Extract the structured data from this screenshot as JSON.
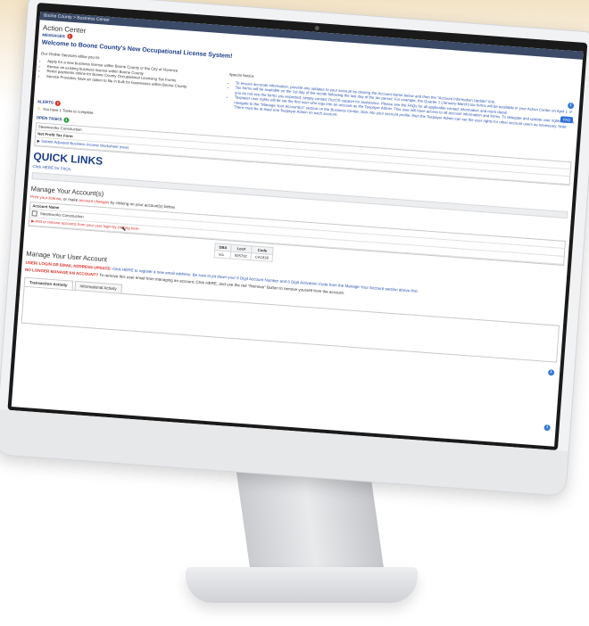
{
  "breadcrumb": {
    "home": "Boone County",
    "sep": ">",
    "current": "Business Center"
  },
  "action_center": {
    "title": "Action Center",
    "messages_label": "MESSAGES",
    "messages_count": "1"
  },
  "welcome": {
    "title": "Welcome to Boone County's New Occupational License System!",
    "intro": "Our Online Services allow you to:",
    "services": [
      "Apply for a new business license within Boone County or the City of Florence",
      "Renew an existing business license within Boone County",
      "Remit payments online for Boone County Occupational Licensing Tax Forms",
      "Service Providers have an option to file in bulk for businesses within Boone County"
    ],
    "special_notice_title": "Special Notice:",
    "notices": [
      "To ensure accurate information, provide any updates to your account by clicking the Account Name below and then the \"Account Information Update\" link.",
      "Tax forms will be available on the 1st day of the month following the last day of the tax period. For example, the Quarter 1 (January-March) tax forms will be available in your Action Center on April 1. If you do not see the forms you expected, simply contact OccOS support for assistance. Please see the FAQs for all applicable contact information and more detail.",
      "Taxpayer user rights will be set the first user who logs into an account as the Taxpayer Admin. This user will have access to all account information and forms. To delegate and update user rights, please navigate to the \"Manage Your Account(s)\" section on the Business Center, click into your account profile, then the Taxpayer Admin can set the user rights for other account users as necessary. Note: There must be at least one Taxpayer Admin on each account."
    ],
    "faq_button": "FAQ"
  },
  "alerts": {
    "label": "ALERTS",
    "count": "1",
    "message": "You have 1 Tasks to complete.",
    "open_tasks_label": "OPEN TASKS",
    "open_tasks_count": "1",
    "company": "Steamworks Construction",
    "form_header": "Net Profit Tax Form",
    "task_link": "Submit Adjusted Business Income Worksheet (new)"
  },
  "quick_links": {
    "title": "QUICK LINKS",
    "faq_link": "Click HERE for FAQs."
  },
  "manage_accounts": {
    "title": "Manage Your Account(s)",
    "print_license": "Print your license",
    "or_make": ", or make",
    "account_changes": "account changes",
    "by_clicking": "by clicking on your account(s) below.",
    "col_account_name": "Account Name",
    "account_row": "Steamworks Construction",
    "add_remove": "Add or remove accounts from your user login by clicking here.",
    "col_dba": "DBA",
    "dba_value": "n/a",
    "col_loc": "Loc#",
    "loc_value": "595792",
    "col_code": "Code",
    "code_value": "CA1836"
  },
  "manage_user": {
    "title": "Manage Your User Account",
    "login_label": "USER/ LOGIN OR EMAIL ADDRESS UPDATE:",
    "login_text": "Click HERE to register a new email address. Be sure to jot down your 6 Digit Account Number and 6 Digit Activation Code from the Manage Your Account section above first.",
    "no_longer_label": "NO LONGER MANAGE AN ACCOUNT?",
    "no_longer_text": "To remove this user email from managing an account, Click HERE, and use the red \"Remove\" Button to remove yourself from the account."
  },
  "tabs": [
    "Transaction Activity",
    "Informational Activity"
  ],
  "colors": {
    "navy": "#1f3f8a",
    "link": "#2d55b0",
    "alert_red": "#d9302a",
    "task_green": "#2f9a45",
    "breadcrumb_bg": "#3a4a67"
  },
  "icons": {
    "info": "info-icon",
    "warning": "warning-icon",
    "cursor": "mouse-cursor-icon"
  }
}
